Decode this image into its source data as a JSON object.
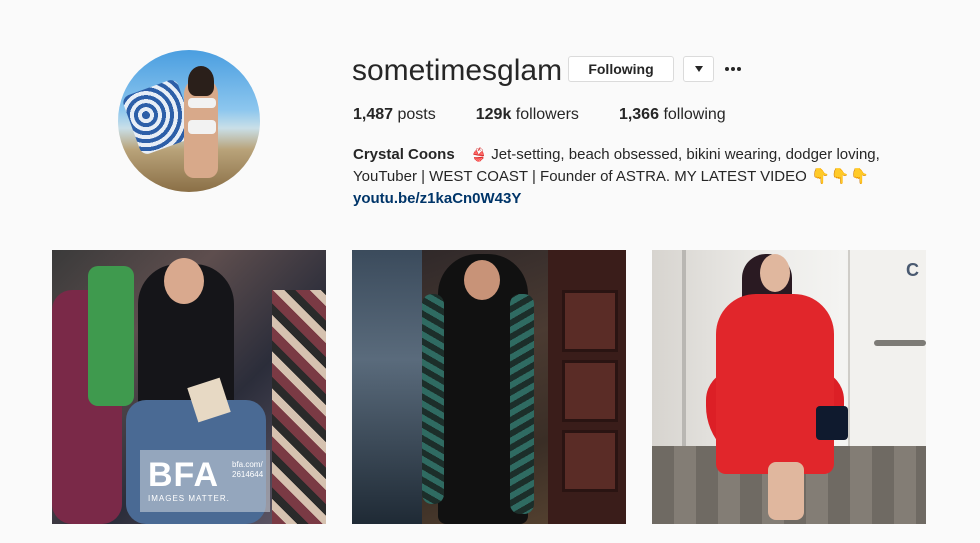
{
  "profile": {
    "username": "sometimesglam",
    "following_label": "Following",
    "stats": {
      "posts_count": "1,487",
      "posts_label": "posts",
      "followers_count": "129k",
      "followers_label": "followers",
      "following_count": "1,366",
      "following_label": "following"
    },
    "bio": {
      "name": "Crystal Coons",
      "line1": "Jet-setting, beach obsessed, bikini wearing, dodger loving,",
      "line2": "YouTuber | WEST COAST | Founder of ASTRA. MY LATEST VIDEO",
      "link": "youtu.be/z1kaCn0W43Y"
    }
  },
  "icons": {
    "bikini": "bikini-icon",
    "hands": "pointing-down-hands-icon",
    "dropdown": "chevron-down-icon",
    "more": "more-options-icon"
  },
  "posts": [
    {
      "id": "post-1",
      "watermark_big": "BFA",
      "watermark_small": "IMAGES MATTER.",
      "watermark_ref_1": "bfa.com/",
      "watermark_ref_2": "2614644"
    },
    {
      "id": "post-2"
    },
    {
      "id": "post-3",
      "sign": "C"
    }
  ],
  "colors": {
    "link": "#003569",
    "text": "#262626",
    "border": "#dbdbdb",
    "background": "#fafafa"
  }
}
